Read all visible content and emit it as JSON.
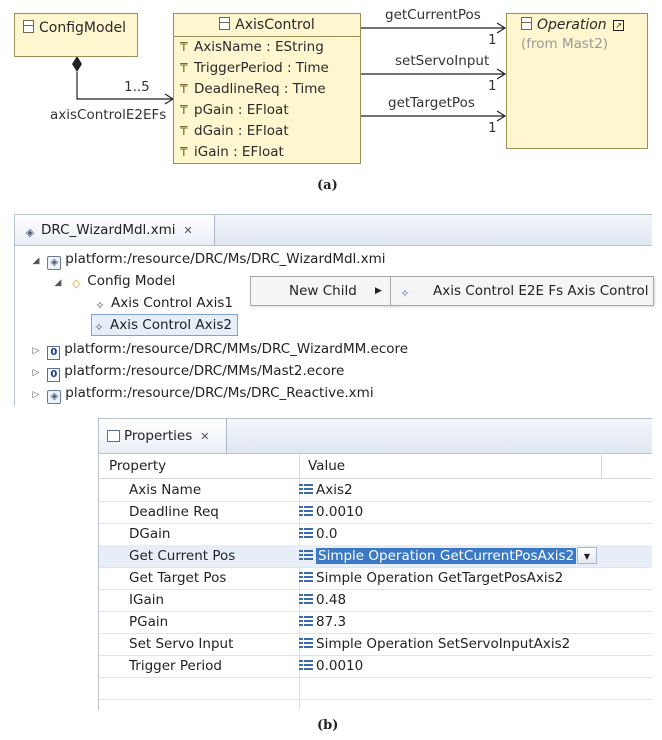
{
  "diagram": {
    "config_model": {
      "name": "ConfigModel",
      "icon": "class-icon"
    },
    "axis_control": {
      "name": "AxisControl",
      "icon": "class-icon",
      "attributes": [
        "AxisName : EString",
        "TriggerPeriod : Time",
        "DeadlineReq : Time",
        "pGain : EFloat",
        "dGain : EFloat",
        "iGain : EFloat"
      ]
    },
    "operation": {
      "name": "Operation",
      "from": "(from Mast2)",
      "icon": "class-icon",
      "shortcut_icon": "shortcut-icon"
    },
    "composition": {
      "multiplicity": "1..5",
      "role": "axisControlE2EFs"
    },
    "associations": [
      {
        "name": "getCurrentPos",
        "multiplicity": "1"
      },
      {
        "name": "setServoInput",
        "multiplicity": "1"
      },
      {
        "name": "getTargetPos",
        "multiplicity": "1"
      }
    ],
    "caption": "(a)",
    "colors": {
      "class_fill": "#fdf6cf",
      "class_border": "#9b8f5a"
    }
  },
  "editor": {
    "tab": {
      "title": "DRC_WizardMdl.xmi",
      "close": "✕"
    },
    "tree": {
      "root": "platform:/resource/DRC/Ms/DRC_WizardMdl.xmi",
      "config_model": "Config Model",
      "axis1": "Axis Control Axis1",
      "axis2": "Axis Control Axis2",
      "resources": [
        "platform:/resource/DRC/MMs/DRC_WizardMM.ecore",
        "platform:/resource/DRC/MMs/Mast2.ecore",
        "platform:/resource/DRC/Ms/DRC_Reactive.xmi"
      ]
    },
    "context_menu": {
      "new_child": "New Child",
      "submenu_item": "Axis Control E2E Fs Axis Control"
    }
  },
  "properties": {
    "tab": {
      "title": "Properties",
      "close": "✕"
    },
    "headers": {
      "property": "Property",
      "value": "Value"
    },
    "rows": [
      {
        "property": "Axis Name",
        "value": "Axis2"
      },
      {
        "property": "Deadline Req",
        "value": "0.0010"
      },
      {
        "property": "DGain",
        "value": "0.0"
      },
      {
        "property": "Get Current Pos",
        "value": "Simple Operation GetCurrentPosAxis2"
      },
      {
        "property": "Get Target Pos",
        "value": "Simple Operation GetTargetPosAxis2"
      },
      {
        "property": "IGain",
        "value": "0.48"
      },
      {
        "property": "PGain",
        "value": "87.3"
      },
      {
        "property": "Set Servo Input",
        "value": "Simple Operation SetServoInputAxis2"
      },
      {
        "property": "Trigger Period",
        "value": "0.0010"
      }
    ],
    "selected_row": 3,
    "selection_color": "#3b78c6"
  },
  "caption_b": "(b)"
}
